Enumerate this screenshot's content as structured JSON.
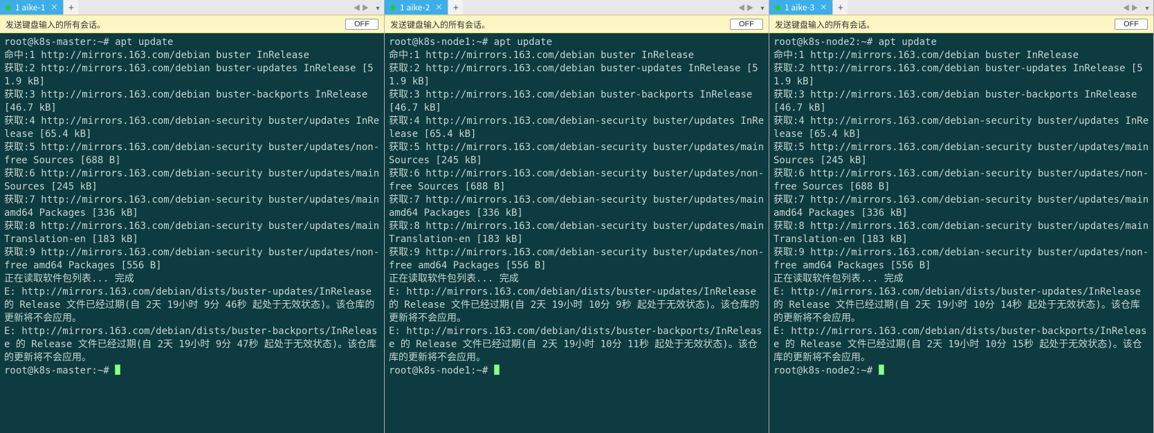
{
  "panes": [
    {
      "tab_label": "1 aike-1",
      "active": true,
      "broadcast_msg": "发送键盘输入的所有会话。",
      "off_label": "OFF",
      "prompt1": "root@k8s-master:~# apt update",
      "body": "命中:1 http://mirrors.163.com/debian buster InRelease\n获取:2 http://mirrors.163.com/debian buster-updates InRelease [51.9 kB]\n获取:3 http://mirrors.163.com/debian buster-backports InRelease [46.7 kB]\n获取:4 http://mirrors.163.com/debian-security buster/updates InRelease [65.4 kB]\n获取:5 http://mirrors.163.com/debian-security buster/updates/non-free Sources [688 B]\n获取:6 http://mirrors.163.com/debian-security buster/updates/main Sources [245 kB]\n获取:7 http://mirrors.163.com/debian-security buster/updates/main amd64 Packages [336 kB]\n获取:8 http://mirrors.163.com/debian-security buster/updates/main Translation-en [183 kB]\n获取:9 http://mirrors.163.com/debian-security buster/updates/non-free amd64 Packages [556 B]\n正在读取软件包列表... 完成\nE: http://mirrors.163.com/debian/dists/buster-updates/InRelease 的 Release 文件已经过期(自 2天 19小时 9分 46秒 起处于无效状态)。该仓库的更新将不会应用。\nE: http://mirrors.163.com/debian/dists/buster-backports/InRelease 的 Release 文件已经过期(自 2天 19小时 9分 47秒 起处于无效状态)。该仓库的更新将不会应用。",
      "prompt2": "root@k8s-master:~# "
    },
    {
      "tab_label": "1 aike-2",
      "active": true,
      "broadcast_msg": "发送键盘输入的所有会话。",
      "off_label": "OFF",
      "prompt1": "root@k8s-node1:~# apt update",
      "body": "命中:1 http://mirrors.163.com/debian buster InRelease\n获取:2 http://mirrors.163.com/debian buster-updates InRelease [51.9 kB]\n获取:3 http://mirrors.163.com/debian buster-backports InRelease [46.7 kB]\n获取:4 http://mirrors.163.com/debian-security buster/updates InRelease [65.4 kB]\n获取:5 http://mirrors.163.com/debian-security buster/updates/main Sources [245 kB]\n获取:6 http://mirrors.163.com/debian-security buster/updates/non-free Sources [688 B]\n获取:7 http://mirrors.163.com/debian-security buster/updates/main amd64 Packages [336 kB]\n获取:8 http://mirrors.163.com/debian-security buster/updates/main Translation-en [183 kB]\n获取:9 http://mirrors.163.com/debian-security buster/updates/non-free amd64 Packages [556 B]\n正在读取软件包列表... 完成\nE: http://mirrors.163.com/debian/dists/buster-updates/InRelease 的 Release 文件已经过期(自 2天 19小时 10分 9秒 起处于无效状态)。该仓库的更新将不会应用。\nE: http://mirrors.163.com/debian/dists/buster-backports/InRelease 的 Release 文件已经过期(自 2天 19小时 10分 11秒 起处于无效状态)。该仓库的更新将不会应用。",
      "prompt2": "root@k8s-node1:~# "
    },
    {
      "tab_label": "1 aike-3",
      "active": true,
      "broadcast_msg": "发送键盘输入的所有会话。",
      "off_label": "OFF",
      "prompt1": "root@k8s-node2:~# apt update",
      "body": "命中:1 http://mirrors.163.com/debian buster InRelease\n获取:2 http://mirrors.163.com/debian buster-updates InRelease [51.9 kB]\n获取:3 http://mirrors.163.com/debian buster-backports InRelease [46.7 kB]\n获取:4 http://mirrors.163.com/debian-security buster/updates InRelease [65.4 kB]\n获取:5 http://mirrors.163.com/debian-security buster/updates/main Sources [245 kB]\n获取:6 http://mirrors.163.com/debian-security buster/updates/non-free Sources [688 B]\n获取:7 http://mirrors.163.com/debian-security buster/updates/main amd64 Packages [336 kB]\n获取:8 http://mirrors.163.com/debian-security buster/updates/main Translation-en [183 kB]\n获取:9 http://mirrors.163.com/debian-security buster/updates/non-free amd64 Packages [556 B]\n正在读取软件包列表... 完成\nE: http://mirrors.163.com/debian/dists/buster-updates/InRelease 的 Release 文件已经过期(自 2天 19小时 10分 14秒 起处于无效状态)。该仓库的更新将不会应用。\nE: http://mirrors.163.com/debian/dists/buster-backports/InRelease 的 Release 文件已经过期(自 2天 19小时 10分 15秒 起处于无效状态)。该仓库的更新将不会应用。",
      "prompt2": "root@k8s-node2:~# "
    }
  ],
  "icons": {
    "close": "×",
    "plus": "+",
    "left": "◀",
    "right": "▶",
    "down": "▾"
  }
}
